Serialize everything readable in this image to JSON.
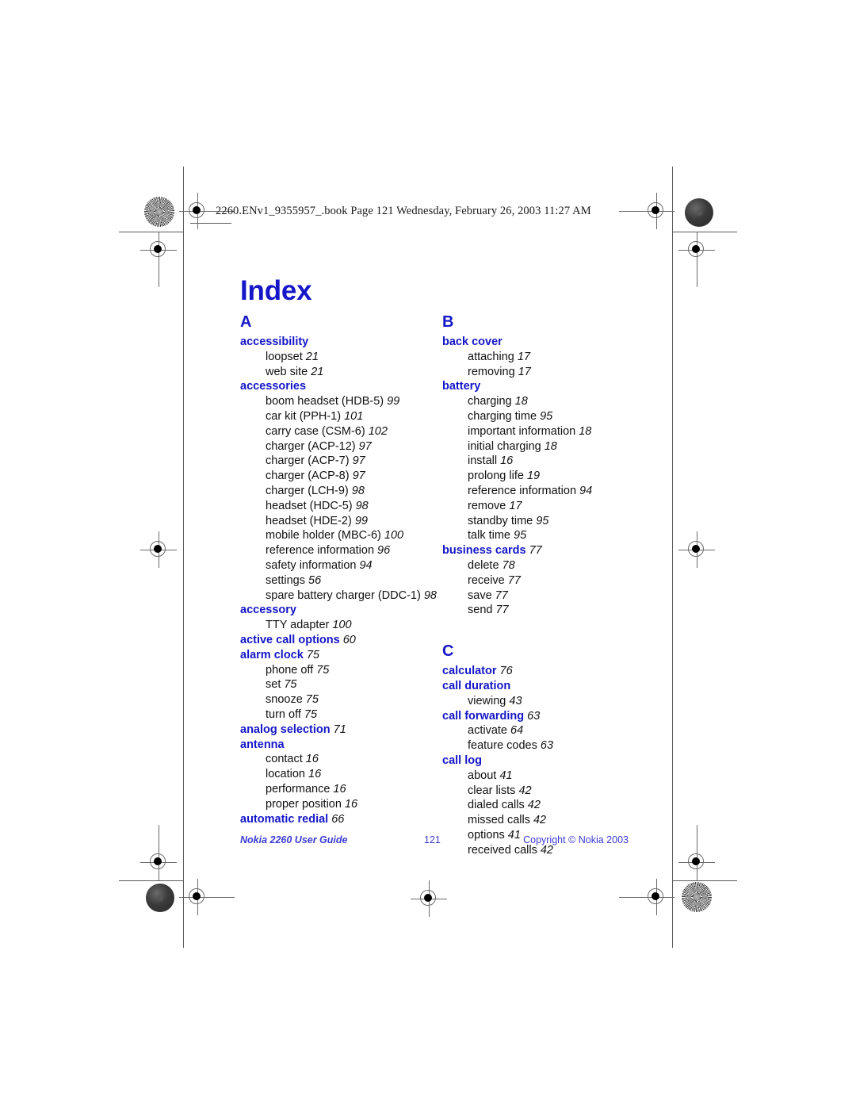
{
  "header": {
    "slug": "2260.ENv1_9355957_.book  Page 121  Wednesday, February 26, 2003  11:27 AM"
  },
  "title": "Index",
  "colors": {
    "heading_blue": "#1416c8",
    "footer_blue": "#3b3bd6",
    "body_black": "#111111"
  },
  "columns": [
    {
      "sections": [
        {
          "letter": "A",
          "entries": [
            {
              "term": "accessibility",
              "page": "",
              "subs": [
                {
                  "text": "loopset",
                  "page": "21"
                },
                {
                  "text": "web site",
                  "page": "21"
                }
              ]
            },
            {
              "term": "accessories",
              "page": "",
              "subs": [
                {
                  "text": "boom headset (HDB-5)",
                  "page": "99"
                },
                {
                  "text": "car kit (PPH-1)",
                  "page": "101"
                },
                {
                  "text": "carry case (CSM-6)",
                  "page": "102"
                },
                {
                  "text": "charger (ACP-12)",
                  "page": "97"
                },
                {
                  "text": "charger (ACP-7)",
                  "page": "97"
                },
                {
                  "text": "charger (ACP-8)",
                  "page": "97"
                },
                {
                  "text": "charger (LCH-9)",
                  "page": "98"
                },
                {
                  "text": "headset (HDC-5)",
                  "page": "98"
                },
                {
                  "text": "headset (HDE-2)",
                  "page": "99"
                },
                {
                  "text": "mobile holder (MBC-6)",
                  "page": "100"
                },
                {
                  "text": "reference information",
                  "page": "96"
                },
                {
                  "text": "safety information",
                  "page": "94"
                },
                {
                  "text": "settings",
                  "page": "56"
                },
                {
                  "text": "spare battery charger (DDC-1)",
                  "page": "98"
                }
              ]
            },
            {
              "term": "accessory",
              "page": "",
              "subs": [
                {
                  "text": "TTY adapter",
                  "page": "100"
                }
              ]
            },
            {
              "term": "active call options",
              "page": "60",
              "subs": []
            },
            {
              "term": "alarm clock",
              "page": "75",
              "subs": [
                {
                  "text": "phone off",
                  "page": "75"
                },
                {
                  "text": "set",
                  "page": "75"
                },
                {
                  "text": "snooze",
                  "page": "75"
                },
                {
                  "text": "turn off",
                  "page": "75"
                }
              ]
            },
            {
              "term": "analog selection",
              "page": "71",
              "subs": []
            },
            {
              "term": "antenna",
              "page": "",
              "subs": [
                {
                  "text": "contact",
                  "page": "16"
                },
                {
                  "text": "location",
                  "page": "16"
                },
                {
                  "text": "performance",
                  "page": "16"
                },
                {
                  "text": "proper position",
                  "page": "16"
                }
              ]
            },
            {
              "term": "automatic redial",
              "page": "66",
              "subs": []
            }
          ]
        }
      ]
    },
    {
      "sections": [
        {
          "letter": "B",
          "entries": [
            {
              "term": "back cover",
              "page": "",
              "subs": [
                {
                  "text": "attaching",
                  "page": "17"
                },
                {
                  "text": "removing",
                  "page": "17"
                }
              ]
            },
            {
              "term": "battery",
              "page": "",
              "subs": [
                {
                  "text": "charging",
                  "page": "18"
                },
                {
                  "text": "charging time",
                  "page": "95"
                },
                {
                  "text": "important information",
                  "page": "18"
                },
                {
                  "text": "initial charging",
                  "page": "18"
                },
                {
                  "text": "install",
                  "page": "16"
                },
                {
                  "text": "prolong life",
                  "page": "19"
                },
                {
                  "text": "reference information",
                  "page": "94"
                },
                {
                  "text": "remove",
                  "page": "17"
                },
                {
                  "text": "standby time",
                  "page": "95"
                },
                {
                  "text": "talk time",
                  "page": "95"
                }
              ]
            },
            {
              "term": "business cards",
              "page": "77",
              "subs": [
                {
                  "text": "delete",
                  "page": "78"
                },
                {
                  "text": "receive",
                  "page": "77"
                },
                {
                  "text": "save",
                  "page": "77"
                },
                {
                  "text": "send",
                  "page": "77"
                }
              ]
            }
          ]
        },
        {
          "letter": "C",
          "entries": [
            {
              "term": "calculator",
              "page": "76",
              "subs": []
            },
            {
              "term": "call duration",
              "page": "",
              "subs": [
                {
                  "text": "viewing",
                  "page": "43"
                }
              ]
            },
            {
              "term": "call forwarding",
              "page": "63",
              "subs": [
                {
                  "text": "activate",
                  "page": "64"
                },
                {
                  "text": "feature codes",
                  "page": "63"
                }
              ]
            },
            {
              "term": "call log",
              "page": "",
              "subs": [
                {
                  "text": "about",
                  "page": "41"
                },
                {
                  "text": "clear lists",
                  "page": "42"
                },
                {
                  "text": "dialed calls",
                  "page": "42"
                },
                {
                  "text": "missed calls",
                  "page": "42"
                },
                {
                  "text": "options",
                  "page": "41"
                },
                {
                  "text": "received calls",
                  "page": "42"
                }
              ]
            }
          ]
        }
      ]
    }
  ],
  "footer": {
    "left": "Nokia 2260 User Guide",
    "center": "121",
    "right": "Copyright © Nokia 2003"
  }
}
